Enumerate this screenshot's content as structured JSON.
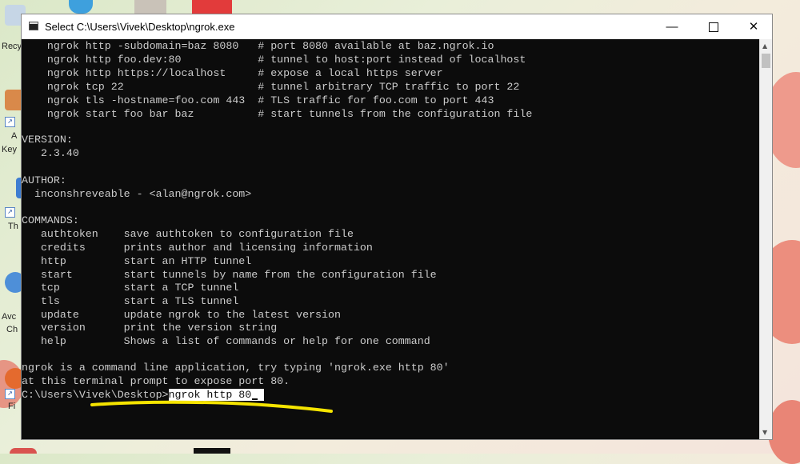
{
  "window": {
    "title": "Select C:\\Users\\Vivek\\Desktop\\ngrok.exe",
    "minimize_glyph": "—",
    "close_glyph": "✕"
  },
  "console": {
    "lines": [
      "    ngrok http -subdomain=baz 8080   # port 8080 available at baz.ngrok.io",
      "    ngrok http foo.dev:80            # tunnel to host:port instead of localhost",
      "    ngrok http https://localhost     # expose a local https server",
      "    ngrok tcp 22                     # tunnel arbitrary TCP traffic to port 22",
      "    ngrok tls -hostname=foo.com 443  # TLS traffic for foo.com to port 443",
      "    ngrok start foo bar baz          # start tunnels from the configuration file",
      "",
      "VERSION:",
      "   2.3.40",
      "",
      "AUTHOR:",
      "  inconshreveable - <alan@ngrok.com>",
      "",
      "COMMANDS:",
      "   authtoken    save authtoken to configuration file",
      "   credits      prints author and licensing information",
      "   http         start an HTTP tunnel",
      "   start        start tunnels by name from the configuration file",
      "   tcp          start a TCP tunnel",
      "   tls          start a TLS tunnel",
      "   update       update ngrok to the latest version",
      "   version      print the version string",
      "   help         Shows a list of commands or help for one command",
      "",
      "ngrok is a command line application, try typing 'ngrok.exe http 80'",
      "at this terminal prompt to expose port 80."
    ],
    "prompt": "C:\\Users\\Vivek\\Desktop>",
    "typed_command": "ngrok http 80"
  },
  "desktop": {
    "labels": [
      "Recy",
      "A",
      "Key",
      "Th",
      "Avc",
      "Ch",
      "Fi"
    ]
  },
  "colors": {
    "console_bg": "#0c0c0c",
    "console_fg": "#cccccc",
    "annotation": "#f5e400"
  }
}
